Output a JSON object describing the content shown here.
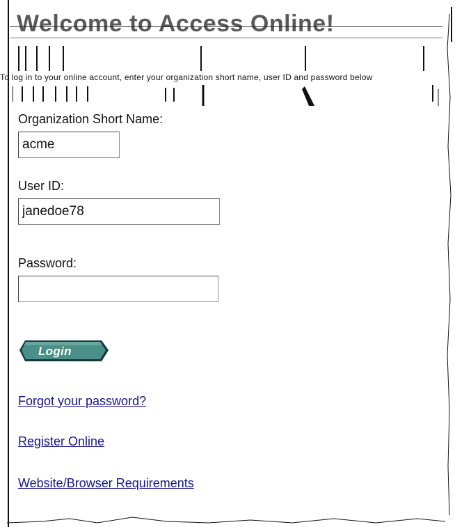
{
  "header": {
    "title": "Welcome to Access Online!",
    "subtitle": "To log in to your online account, enter your organization short name, user ID and password below"
  },
  "form": {
    "org_label": "Organization Short Name:",
    "org_value": "acme",
    "user_label": "User ID:",
    "user_value": "janedoe78",
    "password_label": "Password:",
    "password_value": ""
  },
  "buttons": {
    "login_label": "Login"
  },
  "links": {
    "forgot_password": "Forgot your password?",
    "register": "Register Online",
    "requirements": "Website/Browser Requirements"
  },
  "colors": {
    "link": "#16168a",
    "button_fill": "#4a8f88",
    "button_dark": "#113b38"
  },
  "icons": {
    "login": "login-button-arrow-shape"
  }
}
